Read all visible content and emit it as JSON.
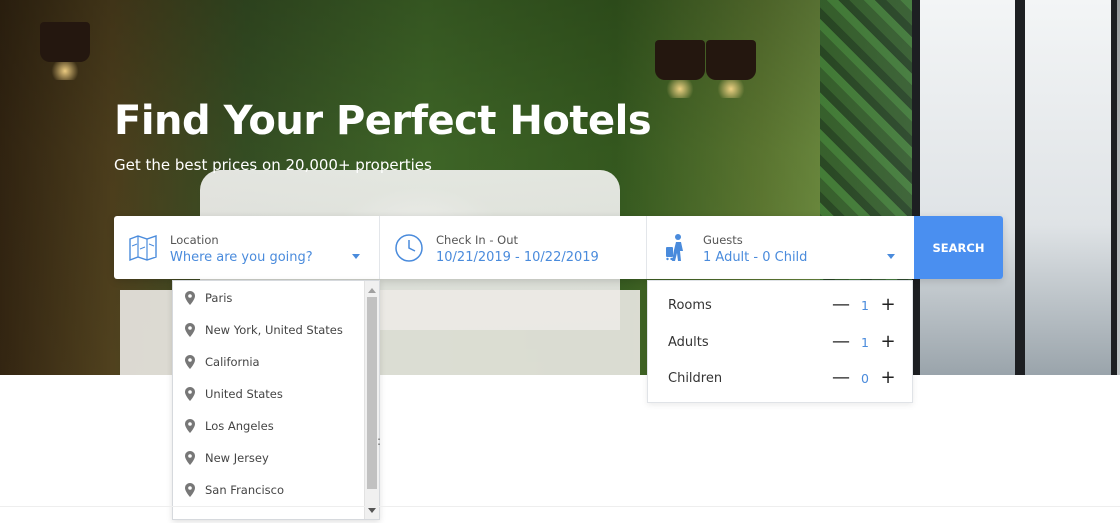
{
  "hero": {
    "title": "Find Your Perfect Hotels",
    "subtitle": "Get the best prices on 20,000+ properties"
  },
  "search": {
    "location": {
      "label": "Location",
      "value": "Where are you going?",
      "icon": "map-icon"
    },
    "dates": {
      "label": "Check In - Out",
      "value": "10/21/2019 - 10/22/2019",
      "icon": "clock-icon"
    },
    "guests": {
      "label": "Guests",
      "value": "1 Adult - 0 Child",
      "icon": "traveler-icon"
    },
    "button_label": "SEARCH"
  },
  "location_dropdown": {
    "items": [
      "Paris",
      "New York, United States",
      "California",
      "United States",
      "Los Angeles",
      "New Jersey",
      "San Francisco"
    ]
  },
  "guests_panel": {
    "rows": [
      {
        "label": "Rooms",
        "value": "1"
      },
      {
        "label": "Adults",
        "value": "1"
      },
      {
        "label": "Children",
        "value": "0"
      }
    ],
    "minus_symbol": "—",
    "plus_symbol": "+"
  },
  "colors": {
    "accent": "#4a8bdc",
    "search_button": "#4a8ff0",
    "pin": "#777777"
  },
  "stray_text": ":"
}
